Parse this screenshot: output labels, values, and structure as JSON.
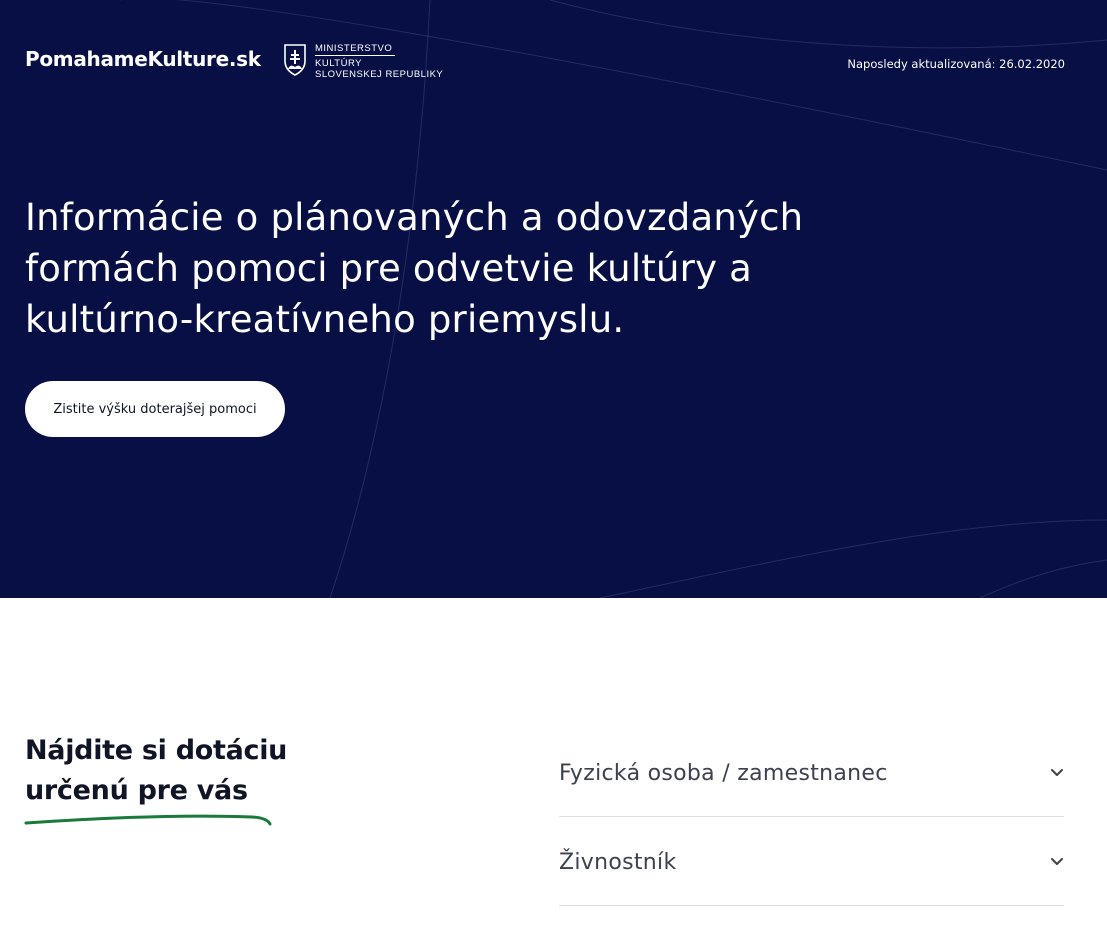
{
  "header": {
    "brand": "PomahameKulture.sk",
    "ministry": {
      "line1": "MINISTERSTVO",
      "line2": "KULTÚRY",
      "line3": "SLOVENSKEJ REPUBLIKY"
    },
    "updated": "Naposledy aktualizovaná: 26.02.2020"
  },
  "hero": {
    "title": "Informácie o plánovaných a odovzdaných formách pomoci pre odvetvie kultúry a kultúrno-kreatívneho priemyslu.",
    "cta_label": "Zistite výšku doterajšej pomoci"
  },
  "section": {
    "title": "Nájdite si dotáciu určenú pre vás"
  },
  "accordion": {
    "items": [
      {
        "label": "Fyzická osoba / zamestnanec",
        "icon": "chevron-down-icon"
      },
      {
        "label": "Živnostník",
        "icon": "chevron-down-icon"
      }
    ]
  },
  "colors": {
    "hero_bg": "#070f45",
    "accent_green": "#1a7a3c",
    "text_dark": "#0f1426"
  }
}
